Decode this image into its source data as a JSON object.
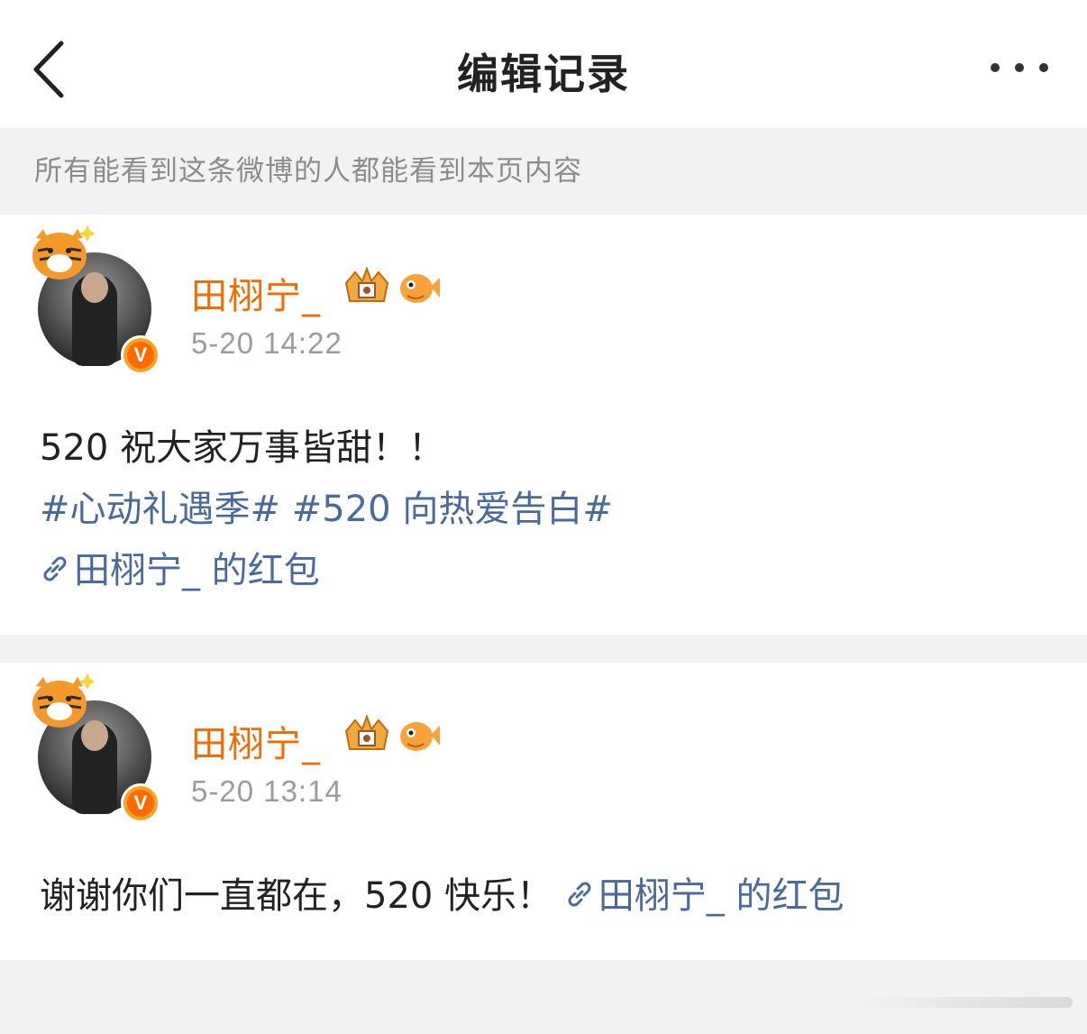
{
  "header": {
    "title": "编辑记录"
  },
  "notice": {
    "text": "所有能看到这条微博的人都能看到本页内容"
  },
  "posts": [
    {
      "author": "田栩宁_",
      "time": "5-20 14:22",
      "lines": [
        [
          {
            "text": "520 祝大家万事皆甜！！",
            "kind": "text"
          }
        ],
        [
          {
            "text": "#心动礼遇季#",
            "kind": "hashtag"
          },
          {
            "text": " #520 向热爱告白#",
            "kind": "hashtag"
          }
        ],
        [
          {
            "text": "田栩宁_ 的红包",
            "kind": "link"
          }
        ]
      ]
    },
    {
      "author": "田栩宁_",
      "time": "5-20 13:14",
      "lines": [
        [
          {
            "text": "谢谢你们一直都在，520 快乐！",
            "kind": "text"
          },
          {
            "text": "田栩宁_ 的红包",
            "kind": "link"
          }
        ]
      ]
    }
  ],
  "colors": {
    "author": "#f06b00",
    "link": "#4a6a9a",
    "meta": "#9b9b9b",
    "background": "#f2f2f4"
  },
  "icons": {
    "back": "chevron-left-icon",
    "more": "more-horizontal-icon",
    "verified": "verified-v-icon",
    "crown": "crown-badge-icon",
    "fish": "pufferfish-badge-icon",
    "link": "link-icon"
  }
}
